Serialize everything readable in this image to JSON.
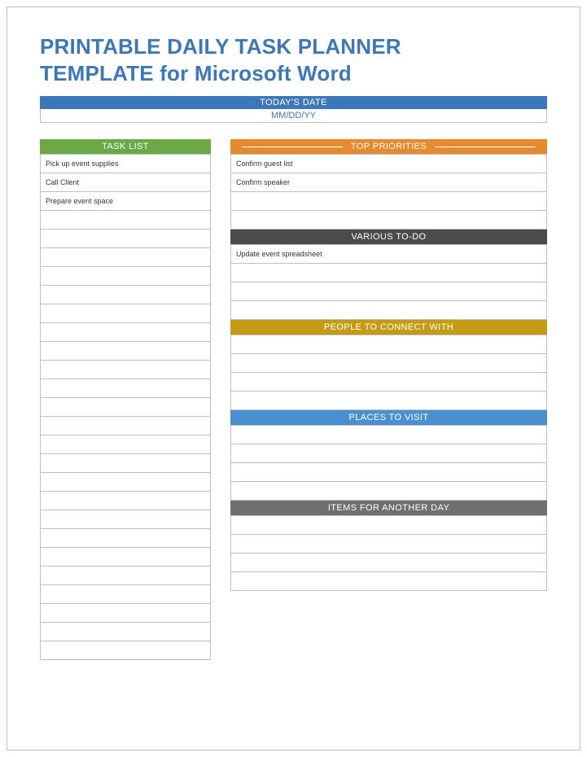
{
  "title_line1": "PRINTABLE DAILY TASK PLANNER",
  "title_line2": "TEMPLATE for Microsoft Word",
  "date": {
    "header": "TODAY'S DATE",
    "value": "MM/DD/YY"
  },
  "task_list": {
    "header": "TASK LIST",
    "rows": [
      "Pick up event supplies",
      "Call Client",
      "Prepare event space",
      "",
      "",
      "",
      "",
      "",
      "",
      "",
      "",
      "",
      "",
      "",
      "",
      "",
      "",
      "",
      "",
      "",
      "",
      "",
      "",
      "",
      "",
      "",
      ""
    ]
  },
  "top_priorities": {
    "header": "TOP PRIORITIES",
    "rows": [
      "Confirm guest list",
      "Confirm speaker",
      "",
      ""
    ]
  },
  "various_todo": {
    "header": "VARIOUS TO-DO",
    "rows": [
      "Update event spreadsheet",
      "",
      "",
      ""
    ]
  },
  "people_connect": {
    "header": "PEOPLE TO CONNECT WITH",
    "rows": [
      "",
      "",
      "",
      ""
    ]
  },
  "places_visit": {
    "header": "PLACES TO VISIT",
    "rows": [
      "",
      "",
      "",
      ""
    ]
  },
  "items_another_day": {
    "header": "ITEMS FOR ANOTHER DAY",
    "rows": [
      "",
      "",
      "",
      ""
    ]
  }
}
